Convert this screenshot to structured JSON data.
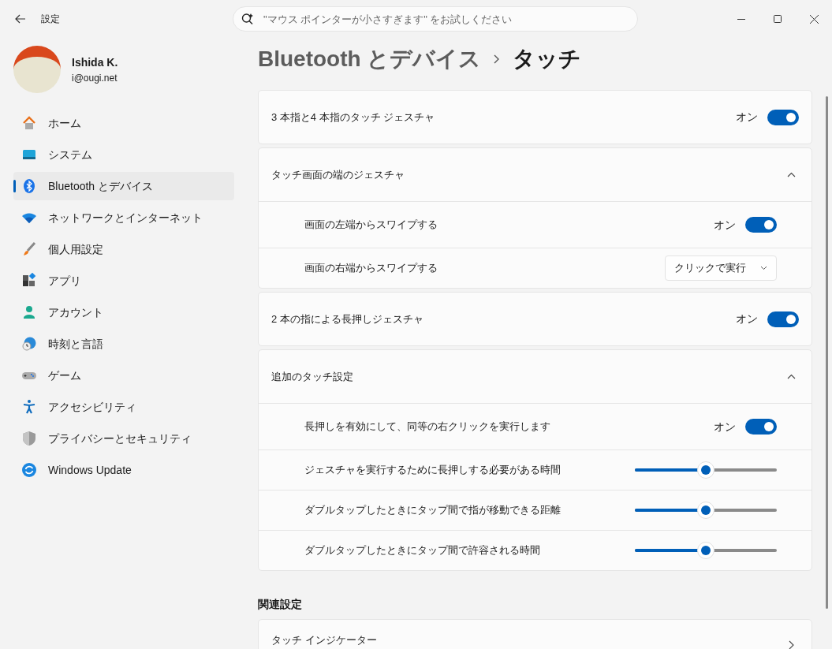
{
  "window": {
    "title": "設定"
  },
  "search": {
    "placeholder": "\"マウス ポインターが小さすぎます\" をお試しください"
  },
  "user": {
    "name": "Ishida K.",
    "email": "i@ougi.net"
  },
  "sidebar": {
    "items": [
      {
        "label": "ホーム",
        "selected": false
      },
      {
        "label": "システム",
        "selected": false
      },
      {
        "label": "Bluetooth とデバイス",
        "selected": true
      },
      {
        "label": "ネットワークとインターネット",
        "selected": false
      },
      {
        "label": "個人用設定",
        "selected": false
      },
      {
        "label": "アプリ",
        "selected": false
      },
      {
        "label": "アカウント",
        "selected": false
      },
      {
        "label": "時刻と言語",
        "selected": false
      },
      {
        "label": "ゲーム",
        "selected": false
      },
      {
        "label": "アクセシビリティ",
        "selected": false
      },
      {
        "label": "プライバシーとセキュリティ",
        "selected": false
      },
      {
        "label": "Windows Update",
        "selected": false
      }
    ]
  },
  "breadcrumb": {
    "parent": "Bluetooth とデバイス",
    "current": "タッチ"
  },
  "sections": [
    {
      "kind": "toggle",
      "label": "3 本指と4 本指のタッチ ジェスチャ",
      "state_text": "オン",
      "on": true
    },
    {
      "kind": "group",
      "title": "タッチ画面の端のジェスチャ",
      "expanded": true,
      "children": [
        {
          "kind": "toggle",
          "label": "画面の左端からスワイプする",
          "state_text": "オン",
          "on": true
        },
        {
          "kind": "dropdown",
          "label": "画面の右端からスワイプする",
          "value": "クリックで実行"
        }
      ]
    },
    {
      "kind": "toggle",
      "label": "2 本の指による長押しジェスチャ",
      "state_text": "オン",
      "on": true
    },
    {
      "kind": "group",
      "title": "追加のタッチ設定",
      "expanded": true,
      "children": [
        {
          "kind": "toggle",
          "label": "長押しを有効にして、同等の右クリックを実行します",
          "state_text": "オン",
          "on": true
        },
        {
          "kind": "slider",
          "label": "ジェスチャを実行するために長押しする必要がある時間",
          "level": 0.5
        },
        {
          "kind": "slider",
          "label": "ダブルタップしたときにタップ間で指が移動できる距離",
          "level": 0.5
        },
        {
          "kind": "slider",
          "label": "ダブルタップしたときにタップ間で許容される時間",
          "level": 0.5
        }
      ]
    }
  ],
  "related": {
    "heading": "関連設定",
    "items": [
      {
        "title": "タッチ インジケーター"
      }
    ]
  }
}
